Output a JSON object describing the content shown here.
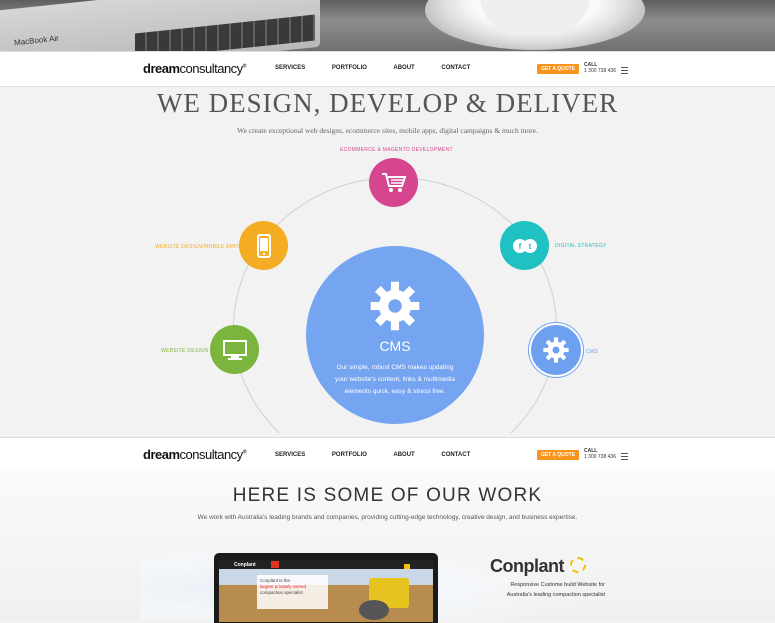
{
  "hero_photo": {
    "laptop_brand": "MacBook Air"
  },
  "nav": {
    "logo_bold": "dream",
    "logo_light": "consultancy",
    "logo_mark": "®",
    "links": [
      "SERVICES",
      "PORTFOLIO",
      "ABOUT",
      "CONTACT"
    ],
    "quote_label": "GET A QUOTE",
    "call_label": "CALL",
    "call_number": "1 300 738 436"
  },
  "hero": {
    "headline": "WE DESIGN, DEVELOP & DELIVER",
    "subline": "We create exceptional web designs, ecommerce sites, mobile apps, digital campaigns & much more."
  },
  "services": {
    "ecommerce": {
      "label": "ECOMMERCE & MAGENTO DEVELOPMENT",
      "icon": "cart-icon",
      "color": "#d6468f"
    },
    "mobile": {
      "label": "WEBSITE DESIGN/MOBILE APPS",
      "icon": "mobile-phone-icon",
      "color": "#f4ac25"
    },
    "digital": {
      "label": "DIGITAL STRATEGY",
      "icon": "social-media-icon",
      "color": "#1fc1c2"
    },
    "web": {
      "label": "WEBSITE DESIGN",
      "icon": "monitor-icon",
      "color": "#7bb53d"
    },
    "cms": {
      "label": "CMS",
      "icon": "gear-icon",
      "color": "#6ea0f0"
    },
    "featured": {
      "title": "CMS",
      "text": "Our simple, robust CMS makes updating your website's content, links & multimedia elements quick, easy & stress free.",
      "icon": "gear-icon"
    }
  },
  "work": {
    "headline": "HERE IS SOME OF OUR WORK",
    "subline": "We work with Australia's leading brands and companies, providing cutting-edge technology, creative design, and business expertise.",
    "screen_logo": "Conplant",
    "screen_text_pre": "Conplant is the",
    "screen_text_highlight": "largest privately owned",
    "screen_text_post": "compaction specialist",
    "brand": "Conplant",
    "brand_desc": "Responsive Custome build Website for Australia's leading compaction specialist"
  }
}
